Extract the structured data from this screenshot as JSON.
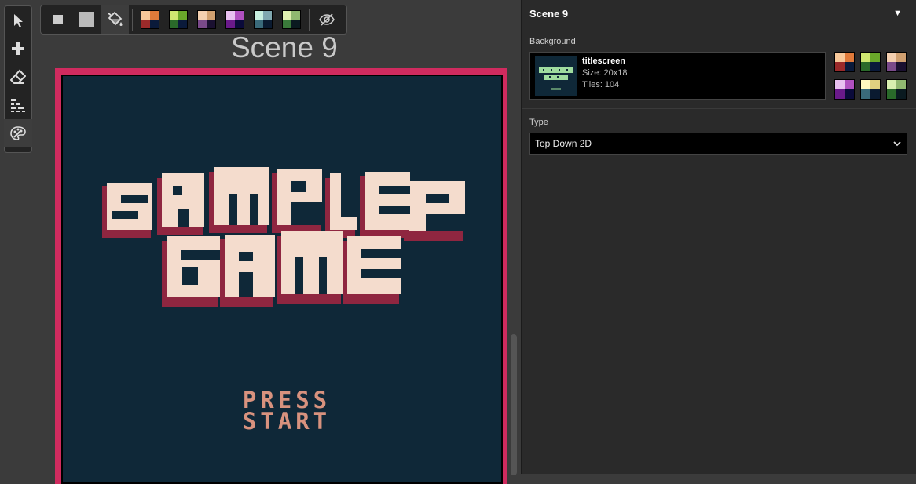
{
  "toolbar_left": {
    "tools": [
      {
        "name": "select-tool",
        "icon": "cursor-icon"
      },
      {
        "name": "add-tool",
        "icon": "plus-icon"
      },
      {
        "name": "eraser-tool",
        "icon": "eraser-icon"
      },
      {
        "name": "collisions-tool",
        "icon": "bricks-icon"
      },
      {
        "name": "colors-tool",
        "icon": "palette-icon",
        "active": true
      }
    ]
  },
  "toolbar_top": {
    "buttons": [
      {
        "name": "pen-1x1-button",
        "icon": "small-square-icon"
      },
      {
        "name": "pen-2x2-button",
        "icon": "large-square-icon"
      },
      {
        "name": "fill-button",
        "icon": "paint-bucket-icon",
        "active": true
      }
    ],
    "palettes": [
      [
        "#f7c89a",
        "#e07a3a",
        "#9a2a2a",
        "#0a1a3a"
      ],
      [
        "#cfe870",
        "#6aa82a",
        "#2a6a2a",
        "#0a1a3a"
      ],
      [
        "#f4d0b0",
        "#d0a070",
        "#7a4a8a",
        "#1a1030"
      ],
      [
        "#e8c0f0",
        "#b050c0",
        "#6a1a8a",
        "#0a0a3a"
      ],
      [
        "#c8f0e0",
        "#80a8b0",
        "#3a6a7a",
        "#0a1a30"
      ],
      [
        "#e0f0b0",
        "#90b870",
        "#3a7a3a",
        "#0a1a20"
      ]
    ],
    "toggle_icon": "eye-off-icon"
  },
  "scene": {
    "title": "Scene 9",
    "press_start": "PRESS\nSTART"
  },
  "panel": {
    "title": "Scene 9",
    "background_label": "Background",
    "background": {
      "name": "titlescreen",
      "size": "Size:  20x18",
      "tiles": "Tiles:  104"
    },
    "palettes": [
      [
        "#f7c89a",
        "#e07a3a",
        "#9a2a2a",
        "#0a1a3a"
      ],
      [
        "#cfe870",
        "#6aa82a",
        "#2a6a2a",
        "#0a1a3a"
      ],
      [
        "#f4d0b0",
        "#d0a070",
        "#7a4a8a",
        "#1a1030"
      ],
      [
        "#e8c0f0",
        "#b050c0",
        "#6a1a8a",
        "#0a0a3a"
      ],
      [
        "#fff8c0",
        "#e0d080",
        "#3a6a7a",
        "#0a1a30"
      ],
      [
        "#d8f0b0",
        "#90b870",
        "#2a6a2a",
        "#0a1a20"
      ]
    ],
    "type_label": "Type",
    "type_value": "Top Down 2D"
  }
}
